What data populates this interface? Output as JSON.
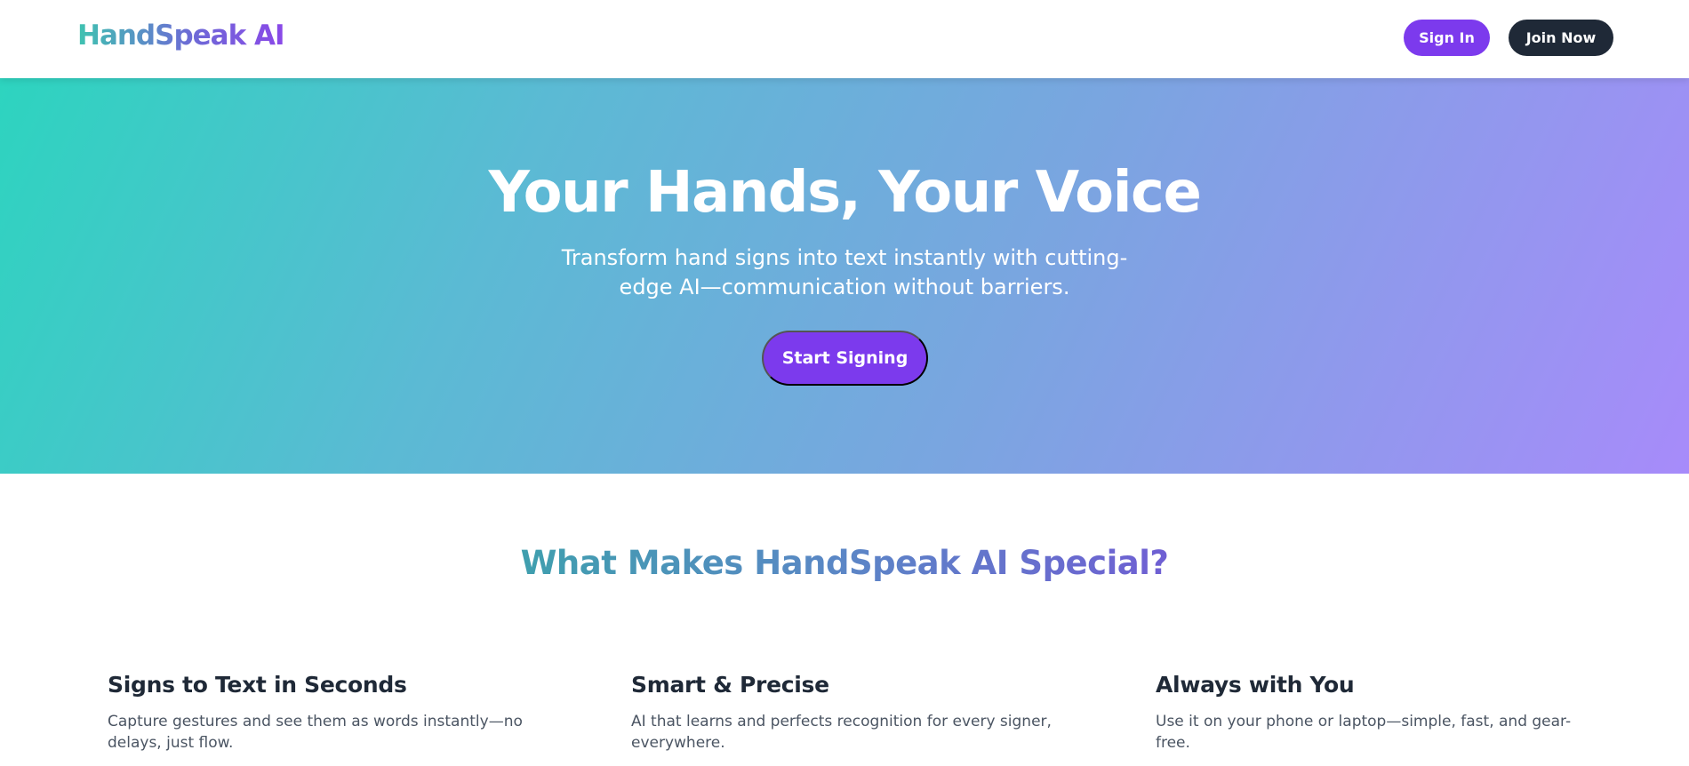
{
  "header": {
    "logo": "HandSpeak AI",
    "signin_label": "Sign In",
    "join_label": "Join Now"
  },
  "hero": {
    "title": "Your Hands, Your Voice",
    "subtitle": "Transform hand signs into text instantly with cutting-edge AI—communication without barriers.",
    "cta_label": "Start Signing"
  },
  "features": {
    "heading": "What Makes HandSpeak AI Special?",
    "items": [
      {
        "title": "Signs to Text in Seconds",
        "desc": "Capture gestures and see them as words instantly—no delays, just flow."
      },
      {
        "title": "Smart & Precise",
        "desc": "AI that learns and perfects recognition for every signer, everywhere."
      },
      {
        "title": "Always with You",
        "desc": "Use it on your phone or laptop—simple, fast, and gear-free."
      }
    ]
  },
  "colors": {
    "accent": "#7c3aed",
    "dark": "#1f2937",
    "hero_gradient_start": "#2dd4bf",
    "hero_gradient_end": "#a78bfa"
  }
}
